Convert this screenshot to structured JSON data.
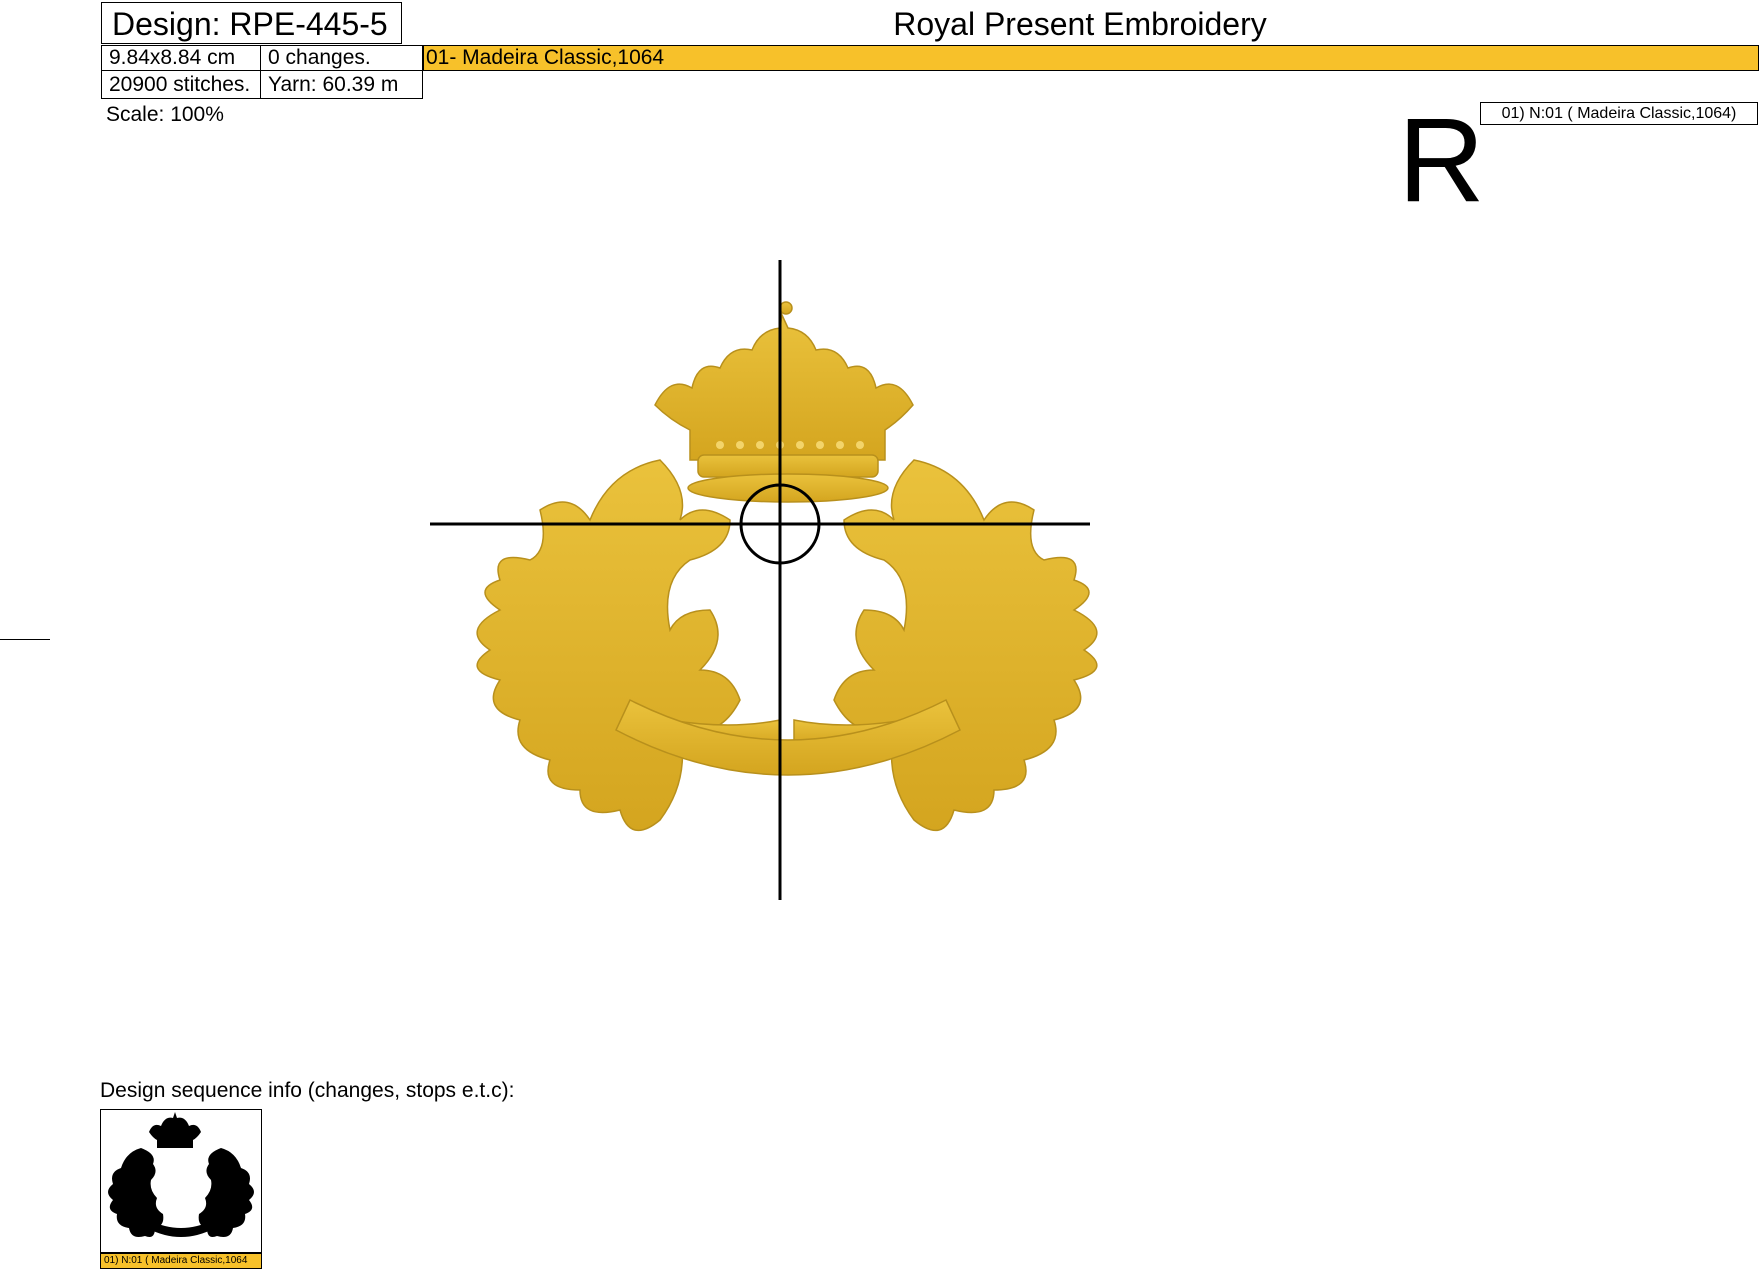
{
  "header": {
    "design_title": "Design: RPE-445-5",
    "size": "9.84x8.84 cm",
    "changes": "0 changes.",
    "stitches": "20900 stitches.",
    "yarn": "Yarn: 60.39 m",
    "site_title": "Royal Present Embroidery"
  },
  "color_bar": {
    "label": "01- Madeira Classic,1064",
    "color": "#f7c12a"
  },
  "scale": "Scale: 100%",
  "logo": "R",
  "thread_label": "01) N:01 ( Madeira Classic,1064)",
  "design_preview": {
    "thread_color": "#e0b52a",
    "icon": "crown-wreath-embroidery-icon"
  },
  "sequence": {
    "title": "Design sequence info (changes, stops e.t.c):",
    "thumb_label": "01) N:01 ( Madeira Classic,1064"
  }
}
